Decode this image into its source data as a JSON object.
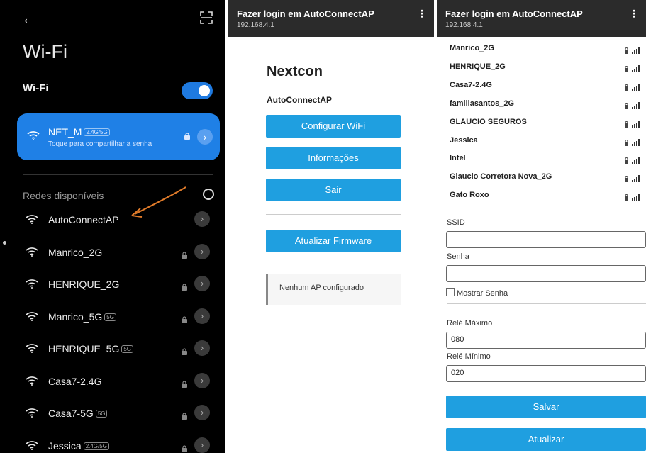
{
  "phone": {
    "title": "Wi-Fi",
    "wifi_label": "Wi-Fi",
    "connected": {
      "name": "NET_M",
      "band": "2.4G/5G",
      "subtitle": "Toque para compartilhar a senha"
    },
    "available_label": "Redes disponíveis",
    "networks": [
      {
        "name": "AutoConnectAP",
        "band": "",
        "locked": false
      },
      {
        "name": "Manrico_2G",
        "band": "",
        "locked": true
      },
      {
        "name": "HENRIQUE_2G",
        "band": "",
        "locked": true
      },
      {
        "name": "Manrico_5G",
        "band": "5G",
        "locked": true
      },
      {
        "name": "HENRIQUE_5G",
        "band": "5G",
        "locked": true
      },
      {
        "name": "Casa7-2.4G",
        "band": "",
        "locked": true
      },
      {
        "name": "Casa7-5G",
        "band": "5G",
        "locked": true
      },
      {
        "name": "Jessica",
        "band": "2.4G/5G",
        "locked": true
      }
    ]
  },
  "portal": {
    "title": "Fazer login em AutoConnectAP",
    "url": "192.168.4.1",
    "brand": "Nextcon",
    "ap_name": "AutoConnectAP",
    "buttons": [
      "Configurar WiFi",
      "Informações",
      "Sair"
    ],
    "firmware_button": "Atualizar Firmware",
    "status": "Nenhum AP configurado"
  },
  "config": {
    "title": "Fazer login em AutoConnectAP",
    "url": "192.168.4.1",
    "networks": [
      "Manrico_2G",
      "HENRIQUE_2G",
      "Casa7-2.4G",
      "familiasantos_2G",
      "GLAUCIO SEGUROS",
      "Jessica",
      "Intel",
      "Glaucio Corretora Nova_2G",
      "Gato Roxo"
    ],
    "ssid_label": "SSID",
    "ssid_value": "",
    "password_label": "Senha",
    "password_value": "",
    "show_password_label": "Mostrar Senha",
    "relay_max_label": "Relé Máximo",
    "relay_max_value": "080",
    "relay_min_label": "Relé Mínimo",
    "relay_min_value": "020",
    "save_button": "Salvar",
    "refresh_button": "Atualizar"
  },
  "colors": {
    "accent": "#1f9fe0",
    "connected_card": "#1f80e6",
    "phone_bg": "#000000",
    "header_bg": "#2b2b2b"
  }
}
